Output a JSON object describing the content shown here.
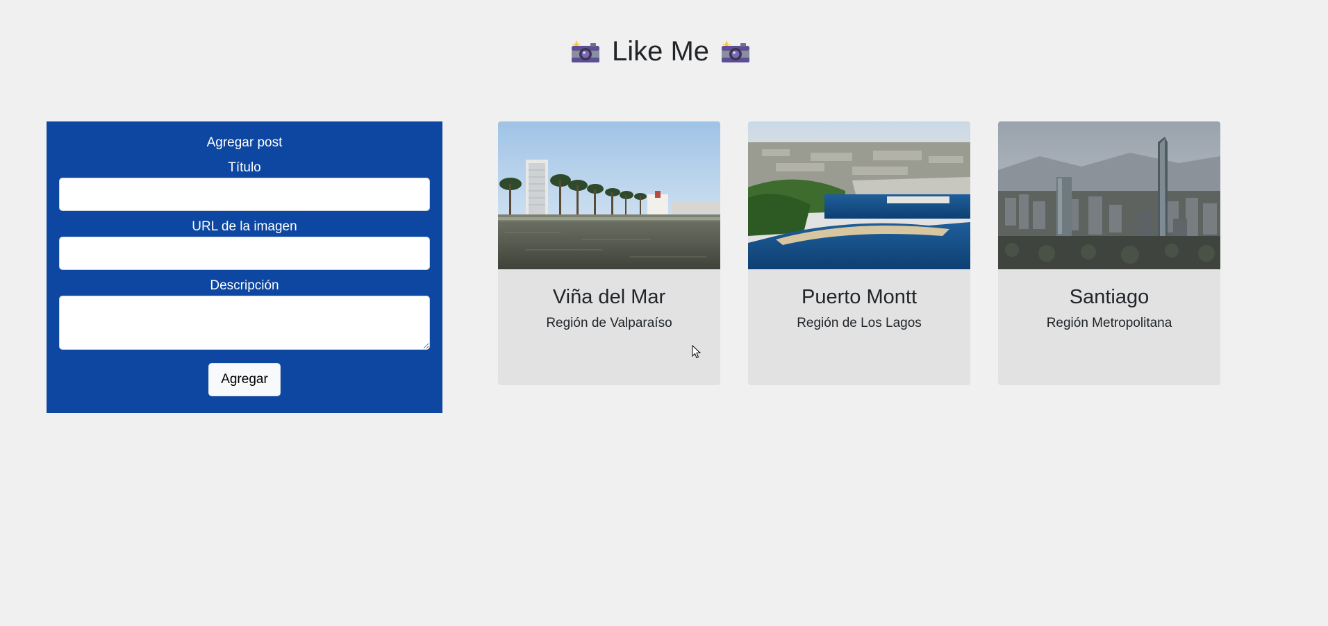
{
  "header": {
    "title": "Like Me",
    "left_icon": "camera-flash-icon",
    "right_icon": "camera-flash-icon"
  },
  "form": {
    "heading": "Agregar post",
    "title_label": "Título",
    "title_value": "",
    "url_label": "URL de la imagen",
    "url_value": "",
    "description_label": "Descripción",
    "description_value": "",
    "submit_label": "Agregar",
    "panel_color": "#0d47a1"
  },
  "posts": [
    {
      "title": "Viña del Mar",
      "subtitle": "Región de Valparaíso",
      "image": "palm-waterfront-photo"
    },
    {
      "title": "Puerto Montt",
      "subtitle": "Región de Los Lagos",
      "image": "aerial-port-city-photo"
    },
    {
      "title": "Santiago",
      "subtitle": "Región Metropolitana",
      "image": "city-skyline-photo"
    }
  ],
  "colors": {
    "background": "#f0f0f0",
    "card_background": "#e2e2e2",
    "accent_blue": "#0d47a1"
  }
}
